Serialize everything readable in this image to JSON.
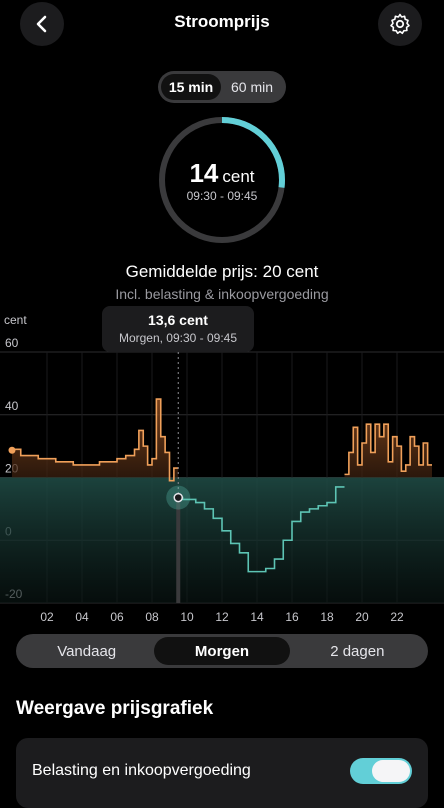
{
  "header": {
    "title": "Stroomprijs",
    "back_icon": "chevron-left-icon",
    "settings_icon": "gear-icon"
  },
  "interval_toggle": {
    "options": [
      "15 min",
      "60 min"
    ],
    "selected": "15 min"
  },
  "current": {
    "value": "14",
    "unit": "cent",
    "time": "09:30 - 09:45",
    "ring_fraction": 0.27
  },
  "average": {
    "text": "Gemiddelde prijs: 20 cent",
    "note": "Incl. belasting & inkoopvergoeding"
  },
  "tooltip": {
    "value": "13,6 cent",
    "time": "Morgen, 09:30 - 09:45"
  },
  "colors": {
    "accent": "#62cfd7",
    "expensive": "#f0a05a",
    "cheap_line": "#5dc4b4"
  },
  "chart_data": {
    "type": "line",
    "ylabel": "cent",
    "ylim": [
      -20,
      60
    ],
    "yticks": [
      "60",
      "40",
      "20",
      "0",
      "-20"
    ],
    "xticks": [
      "02",
      "04",
      "06",
      "08",
      "10",
      "12",
      "14",
      "16",
      "18",
      "20",
      "22"
    ],
    "threshold": 20,
    "selected_hour": 9.5,
    "x_hours": [
      0,
      0.5,
      1,
      1.5,
      2,
      2.5,
      3,
      3.5,
      4,
      4.5,
      5,
      5.5,
      6,
      6.5,
      7,
      7.25,
      7.5,
      7.75,
      8,
      8.25,
      8.5,
      8.75,
      9,
      9.25,
      9.5,
      9.75,
      10,
      10.5,
      11,
      11.5,
      12,
      12.5,
      13,
      13.5,
      14,
      14.5,
      15,
      15.5,
      16,
      16.5,
      17,
      17.5,
      18,
      18.5,
      19,
      19.25,
      19.5,
      19.75,
      20,
      20.25,
      20.5,
      20.75,
      21,
      21.25,
      21.5,
      21.75,
      22,
      22.25,
      22.5,
      22.75,
      23,
      23.25,
      23.5,
      23.75
    ],
    "values": [
      29,
      27,
      27,
      26,
      26,
      25,
      25,
      24,
      24,
      24,
      25,
      25,
      26,
      27,
      29,
      35,
      30,
      24,
      26,
      45,
      33,
      28,
      19,
      23,
      13.6,
      13,
      13,
      12,
      10,
      7,
      3,
      -1,
      -4,
      -10,
      -10,
      -9,
      -6,
      0,
      6,
      9,
      10,
      11,
      12,
      17,
      21,
      28,
      36,
      24,
      31,
      37,
      28,
      37,
      33,
      37,
      25,
      33,
      30,
      22,
      24,
      33,
      30,
      24,
      31,
      24
    ]
  },
  "day_tabs": {
    "options": [
      "Vandaag",
      "Morgen",
      "2 dagen"
    ],
    "selected": "Morgen"
  },
  "display_section": {
    "title": "Weergave prijsgrafiek",
    "toggle_label": "Belasting en inkoopvergoeding",
    "toggle_on": true
  }
}
